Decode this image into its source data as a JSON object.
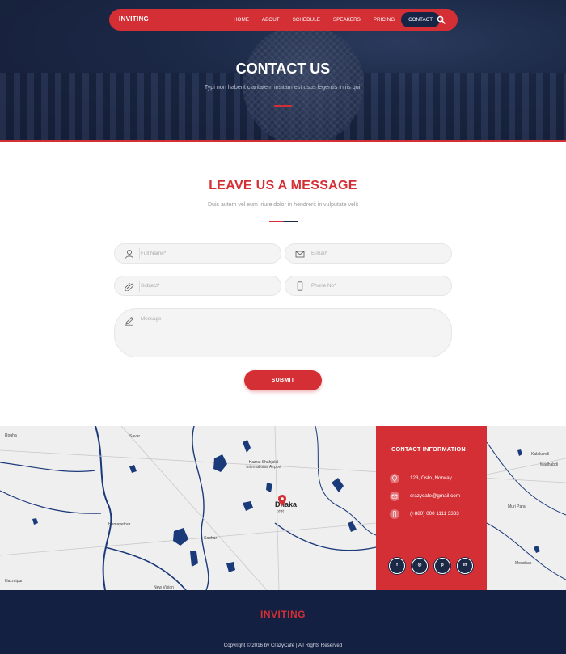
{
  "nav": {
    "brand": "INVITING",
    "items": [
      {
        "label": "HOME"
      },
      {
        "label": "ABOUT"
      },
      {
        "label": "SCHEDULE"
      },
      {
        "label": "SPEAKERS"
      },
      {
        "label": "PRICING"
      },
      {
        "label": "CONTACT"
      }
    ],
    "active": "CONTACT",
    "search_icon": "search-icon"
  },
  "hero": {
    "title": "CONTACT US",
    "subtitle": "Typi non habent claritatem insitam est usus legentis in iis qui."
  },
  "message_section": {
    "title": "LEAVE US A MESSAGE",
    "subtitle": "Duis autem vel eum iriure dolor in hendrerit in vulputate velit",
    "form": {
      "full_name": {
        "placeholder": "Full Name*",
        "value": "",
        "icon": "user-icon"
      },
      "email": {
        "placeholder": "E-mail*",
        "value": "",
        "icon": "envelope-icon"
      },
      "subject": {
        "placeholder": "Subject*",
        "value": "",
        "icon": "paperclip-icon"
      },
      "phone": {
        "placeholder": "Phone No*",
        "value": "",
        "icon": "phone-icon"
      },
      "message": {
        "placeholder": "Message",
        "value": "",
        "icon": "pencil-icon"
      },
      "submit_label": "SUBMIT"
    }
  },
  "map": {
    "city": "Dhaka",
    "city_local": "ঢাকা",
    "labels": [
      "Rouha",
      "Savar",
      "Hazrat Shahjalal International Airport",
      "Hemayetpur",
      "Sabhar",
      "Hazratpur",
      "New Vision",
      "Kalakandi",
      "Madhabdi",
      "Muri Para",
      "Mouchak"
    ]
  },
  "contact_info": {
    "title": "CONTACT INFORMATION",
    "address": "123, Oslo ,Norway",
    "email": "crazycafe@gmail.com",
    "phone": "(+880) 000 1111 3333",
    "icons": [
      "map-pin-icon",
      "envelope-icon",
      "phone-icon"
    ],
    "social": [
      {
        "name": "facebook-icon",
        "glyph": "f"
      },
      {
        "name": "dribbble-icon",
        "glyph": "◎"
      },
      {
        "name": "pinterest-icon",
        "glyph": "p"
      },
      {
        "name": "linkedin-icon",
        "glyph": "in"
      }
    ]
  },
  "footer": {
    "brand": "INVITING",
    "copyright": "Copyright © 2016 by CrazyCafe | All Rights Reserved"
  },
  "colors": {
    "accent": "#d32f35",
    "navy": "#1b2846",
    "footer": "#142041"
  }
}
